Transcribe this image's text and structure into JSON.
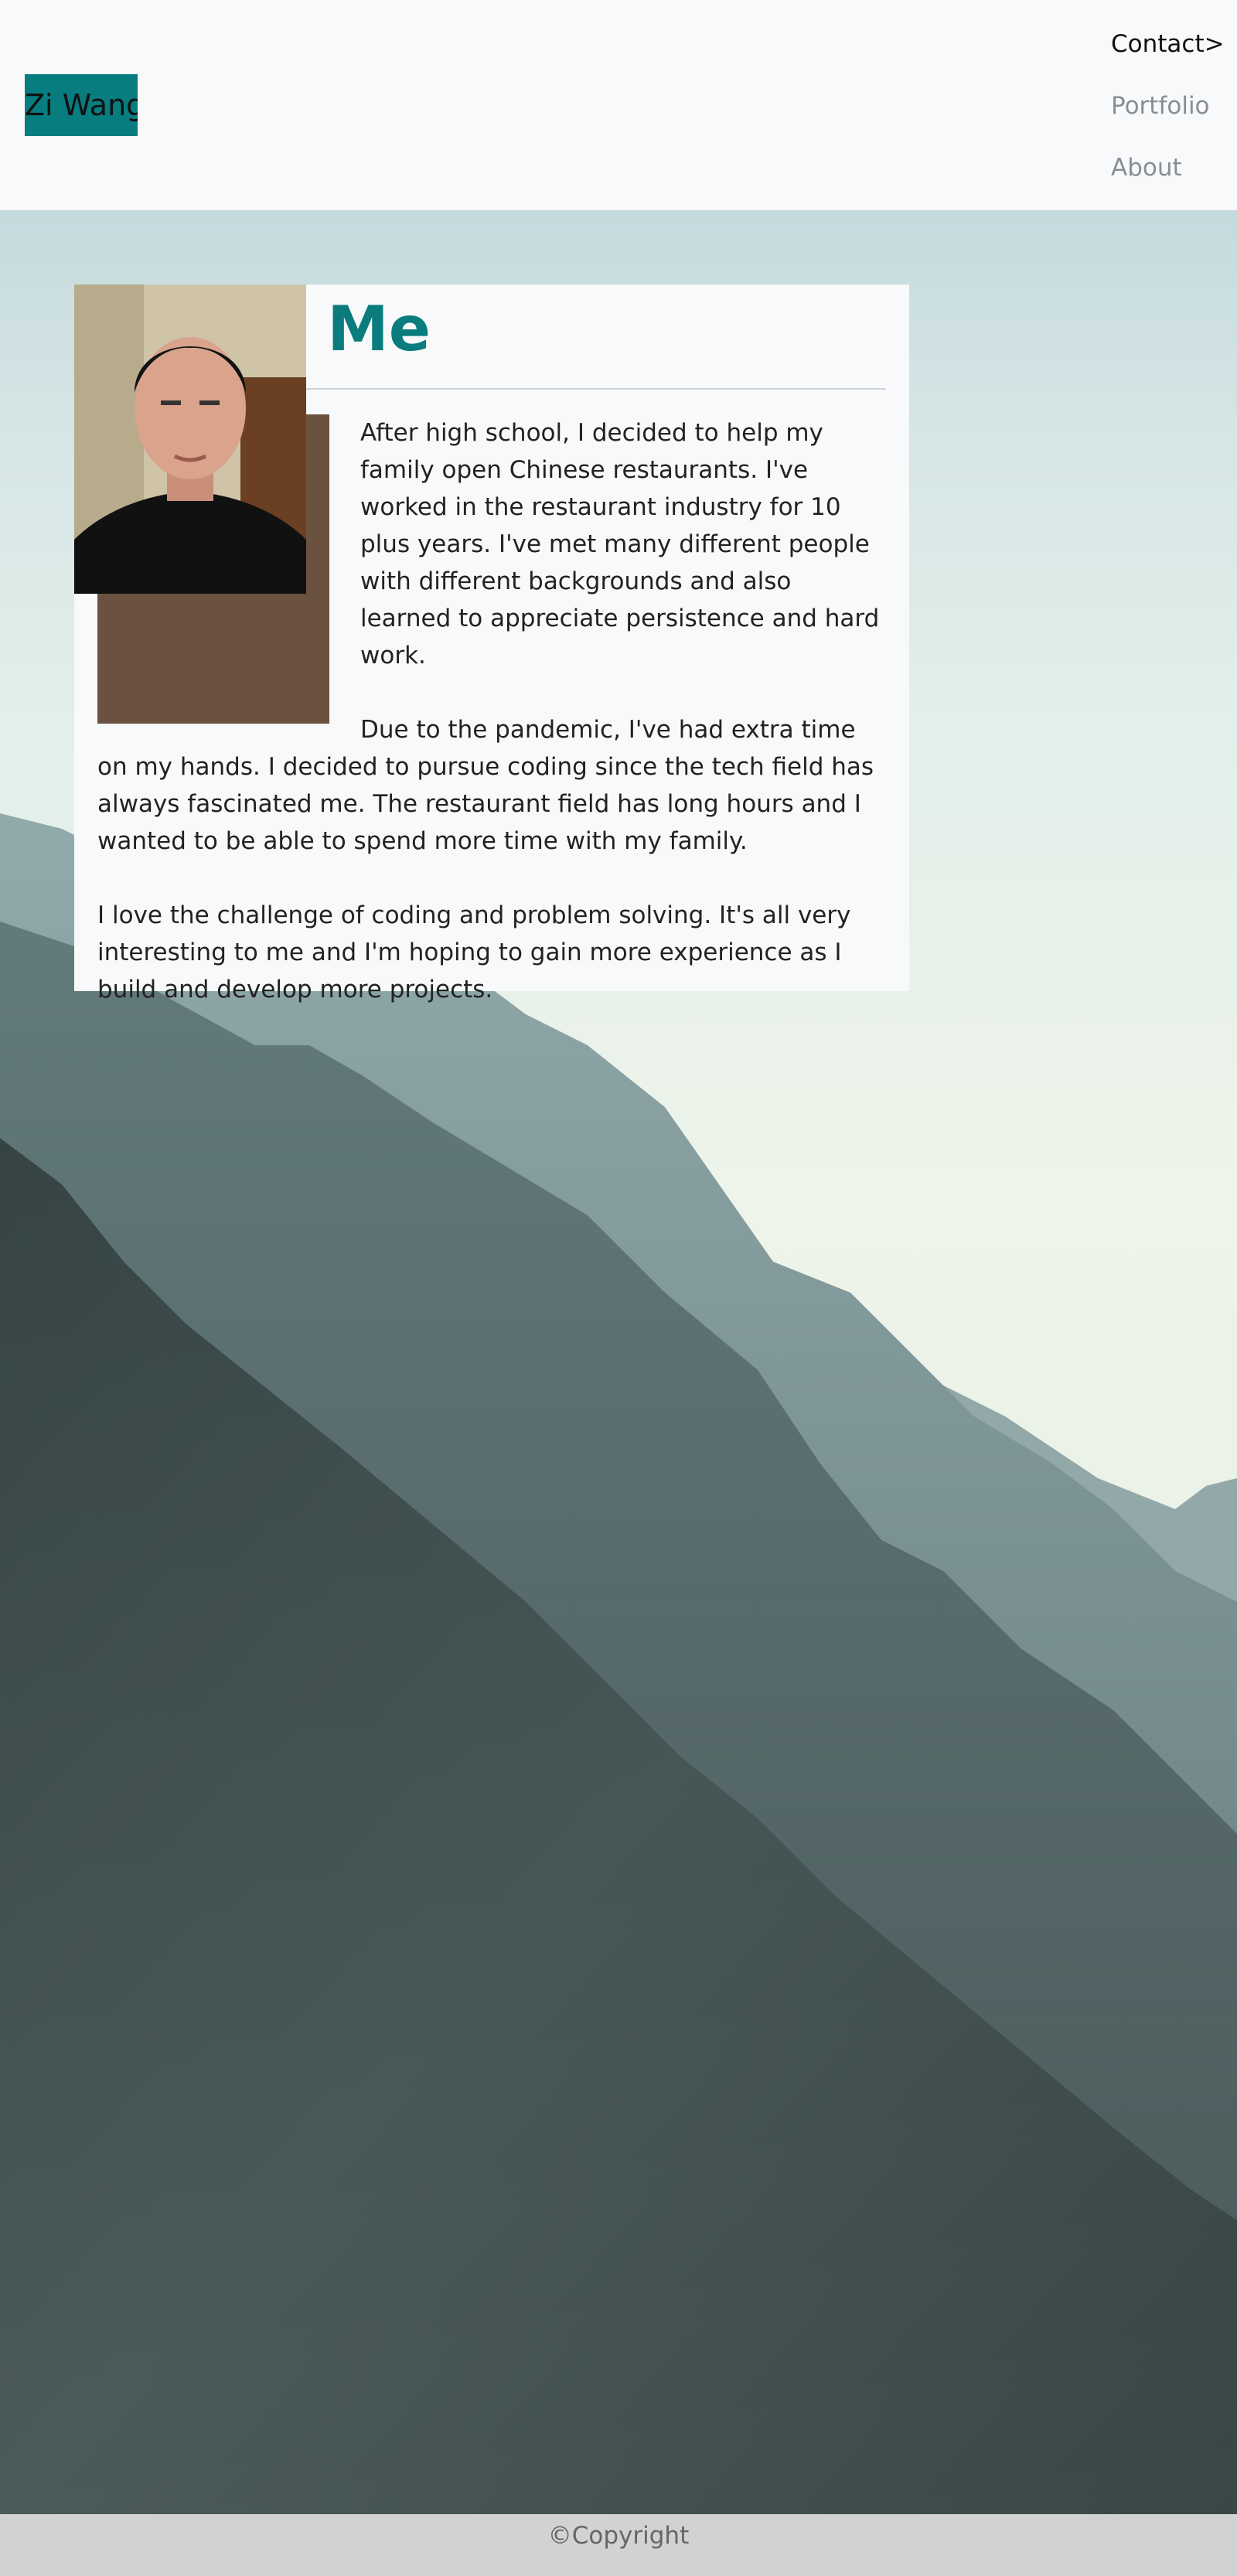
{
  "header": {
    "brand": "Zi Wang",
    "nav": [
      {
        "label": "Contact>",
        "active": true
      },
      {
        "label": "Portfolio",
        "active": false
      },
      {
        "label": "About",
        "active": false
      }
    ]
  },
  "about": {
    "title": "About Me",
    "paragraphs": [
      "After high school, I decided to help my family open Chinese restaurants. I've worked in the restaurant industry for 10 plus years. I've met many different people with different backgrounds and also learned to appreciate persistence and hard work.",
      "Due to the pandemic, I've had extra time on my hands. I decided to pursue coding since the tech field has always fascinated me. The restaurant field has long hours and I wanted to be able to spend more time with my family.",
      "I love the challenge of coding and problem solving. It's all very interesting to me and I'm hoping to gain more experience as I build and develop more projects."
    ]
  },
  "footer": {
    "text": "©Copyright"
  },
  "colors": {
    "accent": "#077d80",
    "title": "#0a7c7e",
    "footer_bg": "#d2d2d2"
  }
}
